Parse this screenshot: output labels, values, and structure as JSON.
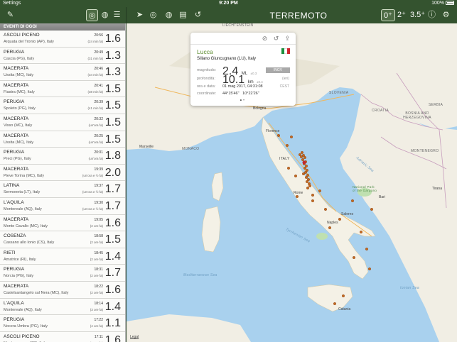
{
  "status": {
    "carrier": "Settings",
    "time": "9:20 PM",
    "battery": "100%"
  },
  "navbar": {
    "title": "TERREMOTO",
    "mag_filters": [
      {
        "label": "0⁺",
        "selected": true
      },
      {
        "label": "2⁺",
        "selected": false
      },
      {
        "label": "3.5⁺",
        "selected": false
      }
    ],
    "icons": [
      "edit-icon",
      "compass-icon",
      "globe-icon",
      "list-icon",
      "compass-icon",
      "globe-icon",
      "document-icon",
      "history-icon",
      "info-icon",
      "gear-icon"
    ]
  },
  "sidebar": {
    "header": "EVENTI DI OGGI",
    "events": [
      {
        "city": "ASCOLI PICENO",
        "place": "Arquata del Tronto (AP), Italy",
        "time": "20:56",
        "ago": "(24 min fa)",
        "mag": "1.6"
      },
      {
        "city": "PERUGIA",
        "place": "Cascia (PG), Italy",
        "time": "20:49",
        "ago": "(31 min fa)",
        "mag": "1.3"
      },
      {
        "city": "MACERATA",
        "place": "Ussita (MC), Italy",
        "time": "20:46",
        "ago": "(34 min fa)",
        "mag": "1.3"
      },
      {
        "city": "MACERATA",
        "place": "Fiastra (MC), Italy",
        "time": "20:41",
        "ago": "(38 min fa)",
        "mag": "1.5"
      },
      {
        "city": "PERUGIA",
        "place": "Spoleto (PG), Italy",
        "time": "20:39",
        "ago": "(41 min fa)",
        "mag": "1.5"
      },
      {
        "city": "MACERATA",
        "place": "Visso (MC), Italy",
        "time": "20:32",
        "ago": "(un'ora fa)",
        "mag": "1.5"
      },
      {
        "city": "MACERATA",
        "place": "Ussita (MC), Italy",
        "time": "20:25",
        "ago": "(un'ora fa)",
        "mag": "1.5"
      },
      {
        "city": "PERUGIA",
        "place": "Preci (PG), Italy",
        "time": "20:01",
        "ago": "(un'ora fa)",
        "mag": "1.8"
      },
      {
        "city": "MACERATA",
        "place": "Pieve Torina (MC), Italy",
        "time": "19:39",
        "ago": "(un'ora e ½ fa)",
        "mag": "2.0"
      },
      {
        "city": "LATINA",
        "place": "Sermoneta (LT), Italy",
        "time": "19:37",
        "ago": "(un'ora e ½ fa)",
        "mag": "1.7"
      },
      {
        "city": "L'AQUILA",
        "place": "Montereale (AQ), Italy",
        "time": "19:30",
        "ago": "(un'ora e ½ fa)",
        "mag": "1.7"
      },
      {
        "city": "MACERATA",
        "place": "Monte Cavallo (MC), Italy",
        "time": "19:05",
        "ago": "(2 ore fa)",
        "mag": "1.6"
      },
      {
        "city": "COSENZA",
        "place": "Cassano allo Ionio (CS), Italy",
        "time": "18:58",
        "ago": "(2 ore fa)",
        "mag": "1.5"
      },
      {
        "city": "RIETI",
        "place": "Amatrice (RI), Italy",
        "time": "18:45",
        "ago": "(2 ore fa)",
        "mag": "1.4"
      },
      {
        "city": "PERUGIA",
        "place": "Norcia (PG), Italy",
        "time": "18:31",
        "ago": "(2 ore fa)",
        "mag": "1.7"
      },
      {
        "city": "MACERATA",
        "place": "Castelsantangelo sul Nera (MC), Italy",
        "time": "18:22",
        "ago": "(2 ore fa)",
        "mag": "1.6"
      },
      {
        "city": "L'AQUILA",
        "place": "Montereale (AQ), Italy",
        "time": "18:14",
        "ago": "(3 ore fa)",
        "mag": "1.4"
      },
      {
        "city": "PERUGIA",
        "place": "Nocera Umbra (PG), Italy",
        "time": "17:22",
        "ago": "(4 ore fa)",
        "mag": "1.1"
      },
      {
        "city": "ASCOLI PICENO",
        "place": "Montemonaco (AP), Italy",
        "time": "17:11",
        "ago": "(4 ore fa)",
        "mag": "1.6"
      }
    ]
  },
  "popup": {
    "title": "Lucca",
    "subtitle": "Sillano Giuncugnano (LU), Italy",
    "mag_key": "magnitudo:",
    "mag_value": "2.4",
    "mag_unit": "ML",
    "mag_err": "±0.3",
    "source": "INGV",
    "depth_key": "profondità:",
    "depth_value": "10.1",
    "depth_unit": "km",
    "depth_err": "±0.4",
    "depth_tag": "(ieri)",
    "date_key": "ora e data:",
    "date_value": "01 mag 2017, 04:31:08",
    "date_tag": "CEST",
    "coord_key": "coordinate:",
    "coord_value": "44°15'46\"   10°22'26\"",
    "icons": [
      "block-icon",
      "history-icon",
      "share-icon"
    ]
  },
  "map": {
    "labels": [
      {
        "text": "LIECHTENSTEIN",
        "type": "country"
      },
      {
        "text": "SLOVENIA",
        "type": "country"
      },
      {
        "text": "CROATIA",
        "type": "country"
      },
      {
        "text": "BOSNIA AND HERZEGOVINA",
        "type": "country"
      },
      {
        "text": "SERBIA",
        "type": "country"
      },
      {
        "text": "MONTENEGRO",
        "type": "country"
      },
      {
        "text": "ITALY",
        "type": "country"
      },
      {
        "text": "MONACO",
        "type": "country"
      },
      {
        "text": "Marseille",
        "type": "city"
      },
      {
        "text": "Bologna",
        "type": "city"
      },
      {
        "text": "Florence",
        "type": "city"
      },
      {
        "text": "Rome",
        "type": "city"
      },
      {
        "text": "Naples",
        "type": "city"
      },
      {
        "text": "Salerno",
        "type": "city"
      },
      {
        "text": "Bari",
        "type": "city"
      },
      {
        "text": "Tirana",
        "type": "city"
      },
      {
        "text": "Catania",
        "type": "city"
      },
      {
        "text": "Mediterranean Sea",
        "type": "sea"
      },
      {
        "text": "Tyrrhenian Sea",
        "type": "sea"
      },
      {
        "text": "Adriatic Sea",
        "type": "sea"
      },
      {
        "text": "Ionian Sea",
        "type": "sea"
      },
      {
        "text": "National Park of the Gargano",
        "type": "park"
      },
      {
        "text": "Legal",
        "type": "link"
      }
    ]
  }
}
